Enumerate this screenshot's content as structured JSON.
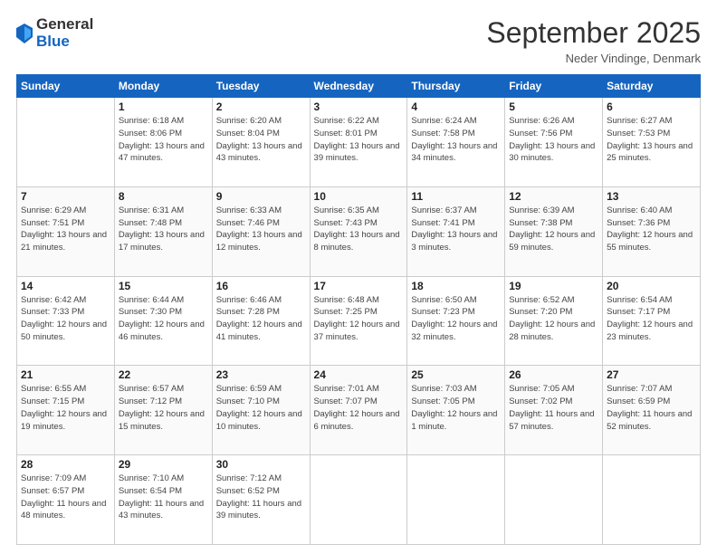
{
  "header": {
    "logo_general": "General",
    "logo_blue": "Blue",
    "month_title": "September 2025",
    "subtitle": "Neder Vindinge, Denmark"
  },
  "weekdays": [
    "Sunday",
    "Monday",
    "Tuesday",
    "Wednesday",
    "Thursday",
    "Friday",
    "Saturday"
  ],
  "weeks": [
    [
      {
        "day": "",
        "info": ""
      },
      {
        "day": "1",
        "info": "Sunrise: 6:18 AM\nSunset: 8:06 PM\nDaylight: 13 hours\nand 47 minutes."
      },
      {
        "day": "2",
        "info": "Sunrise: 6:20 AM\nSunset: 8:04 PM\nDaylight: 13 hours\nand 43 minutes."
      },
      {
        "day": "3",
        "info": "Sunrise: 6:22 AM\nSunset: 8:01 PM\nDaylight: 13 hours\nand 39 minutes."
      },
      {
        "day": "4",
        "info": "Sunrise: 6:24 AM\nSunset: 7:58 PM\nDaylight: 13 hours\nand 34 minutes."
      },
      {
        "day": "5",
        "info": "Sunrise: 6:26 AM\nSunset: 7:56 PM\nDaylight: 13 hours\nand 30 minutes."
      },
      {
        "day": "6",
        "info": "Sunrise: 6:27 AM\nSunset: 7:53 PM\nDaylight: 13 hours\nand 25 minutes."
      }
    ],
    [
      {
        "day": "7",
        "info": "Sunrise: 6:29 AM\nSunset: 7:51 PM\nDaylight: 13 hours\nand 21 minutes."
      },
      {
        "day": "8",
        "info": "Sunrise: 6:31 AM\nSunset: 7:48 PM\nDaylight: 13 hours\nand 17 minutes."
      },
      {
        "day": "9",
        "info": "Sunrise: 6:33 AM\nSunset: 7:46 PM\nDaylight: 13 hours\nand 12 minutes."
      },
      {
        "day": "10",
        "info": "Sunrise: 6:35 AM\nSunset: 7:43 PM\nDaylight: 13 hours\nand 8 minutes."
      },
      {
        "day": "11",
        "info": "Sunrise: 6:37 AM\nSunset: 7:41 PM\nDaylight: 13 hours\nand 3 minutes."
      },
      {
        "day": "12",
        "info": "Sunrise: 6:39 AM\nSunset: 7:38 PM\nDaylight: 12 hours\nand 59 minutes."
      },
      {
        "day": "13",
        "info": "Sunrise: 6:40 AM\nSunset: 7:36 PM\nDaylight: 12 hours\nand 55 minutes."
      }
    ],
    [
      {
        "day": "14",
        "info": "Sunrise: 6:42 AM\nSunset: 7:33 PM\nDaylight: 12 hours\nand 50 minutes."
      },
      {
        "day": "15",
        "info": "Sunrise: 6:44 AM\nSunset: 7:30 PM\nDaylight: 12 hours\nand 46 minutes."
      },
      {
        "day": "16",
        "info": "Sunrise: 6:46 AM\nSunset: 7:28 PM\nDaylight: 12 hours\nand 41 minutes."
      },
      {
        "day": "17",
        "info": "Sunrise: 6:48 AM\nSunset: 7:25 PM\nDaylight: 12 hours\nand 37 minutes."
      },
      {
        "day": "18",
        "info": "Sunrise: 6:50 AM\nSunset: 7:23 PM\nDaylight: 12 hours\nand 32 minutes."
      },
      {
        "day": "19",
        "info": "Sunrise: 6:52 AM\nSunset: 7:20 PM\nDaylight: 12 hours\nand 28 minutes."
      },
      {
        "day": "20",
        "info": "Sunrise: 6:54 AM\nSunset: 7:17 PM\nDaylight: 12 hours\nand 23 minutes."
      }
    ],
    [
      {
        "day": "21",
        "info": "Sunrise: 6:55 AM\nSunset: 7:15 PM\nDaylight: 12 hours\nand 19 minutes."
      },
      {
        "day": "22",
        "info": "Sunrise: 6:57 AM\nSunset: 7:12 PM\nDaylight: 12 hours\nand 15 minutes."
      },
      {
        "day": "23",
        "info": "Sunrise: 6:59 AM\nSunset: 7:10 PM\nDaylight: 12 hours\nand 10 minutes."
      },
      {
        "day": "24",
        "info": "Sunrise: 7:01 AM\nSunset: 7:07 PM\nDaylight: 12 hours\nand 6 minutes."
      },
      {
        "day": "25",
        "info": "Sunrise: 7:03 AM\nSunset: 7:05 PM\nDaylight: 12 hours\nand 1 minute."
      },
      {
        "day": "26",
        "info": "Sunrise: 7:05 AM\nSunset: 7:02 PM\nDaylight: 11 hours\nand 57 minutes."
      },
      {
        "day": "27",
        "info": "Sunrise: 7:07 AM\nSunset: 6:59 PM\nDaylight: 11 hours\nand 52 minutes."
      }
    ],
    [
      {
        "day": "28",
        "info": "Sunrise: 7:09 AM\nSunset: 6:57 PM\nDaylight: 11 hours\nand 48 minutes."
      },
      {
        "day": "29",
        "info": "Sunrise: 7:10 AM\nSunset: 6:54 PM\nDaylight: 11 hours\nand 43 minutes."
      },
      {
        "day": "30",
        "info": "Sunrise: 7:12 AM\nSunset: 6:52 PM\nDaylight: 11 hours\nand 39 minutes."
      },
      {
        "day": "",
        "info": ""
      },
      {
        "day": "",
        "info": ""
      },
      {
        "day": "",
        "info": ""
      },
      {
        "day": "",
        "info": ""
      }
    ]
  ]
}
